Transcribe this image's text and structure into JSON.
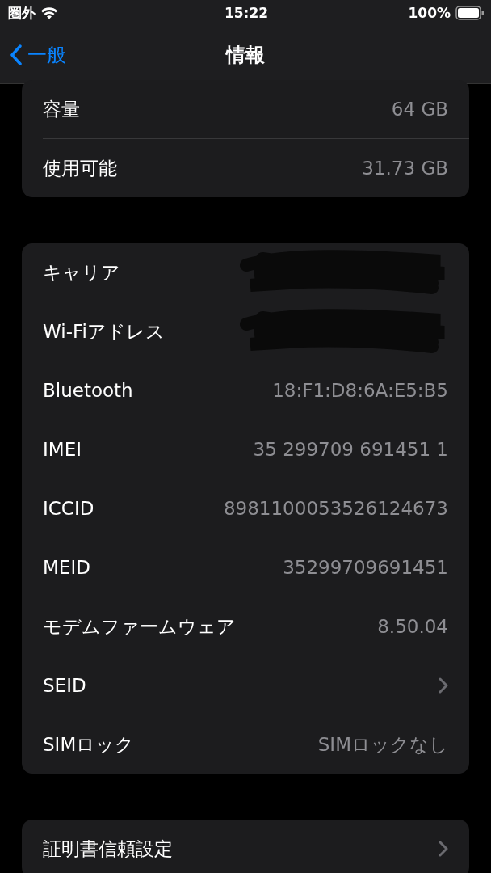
{
  "status_bar": {
    "carrier": "圏外",
    "time": "15:22",
    "battery": "100%"
  },
  "nav": {
    "back": "一般",
    "title": "情報"
  },
  "groups": [
    {
      "rows": [
        {
          "kind": "value",
          "label": "容量",
          "value": "64 GB"
        },
        {
          "kind": "value",
          "label": "使用可能",
          "value": "31.73 GB"
        }
      ]
    },
    {
      "rows": [
        {
          "kind": "redacted",
          "label": "キャリア"
        },
        {
          "kind": "redacted",
          "label": "Wi-Fiアドレス"
        },
        {
          "kind": "value",
          "label": "Bluetooth",
          "value": "18:F1:D8:6A:E5:B5"
        },
        {
          "kind": "value",
          "label": "IMEI",
          "value": "35 299709 691451 1"
        },
        {
          "kind": "value",
          "label": "ICCID",
          "value": "8981100053526124673"
        },
        {
          "kind": "value",
          "label": "MEID",
          "value": "35299709691451"
        },
        {
          "kind": "value",
          "label": "モデムファームウェア",
          "value": "8.50.04"
        },
        {
          "kind": "link",
          "label": "SEID"
        },
        {
          "kind": "value",
          "label": "SIMロック",
          "value": "SIMロックなし"
        }
      ]
    },
    {
      "rows": [
        {
          "kind": "link",
          "label": "証明書信頼設定"
        }
      ]
    }
  ]
}
